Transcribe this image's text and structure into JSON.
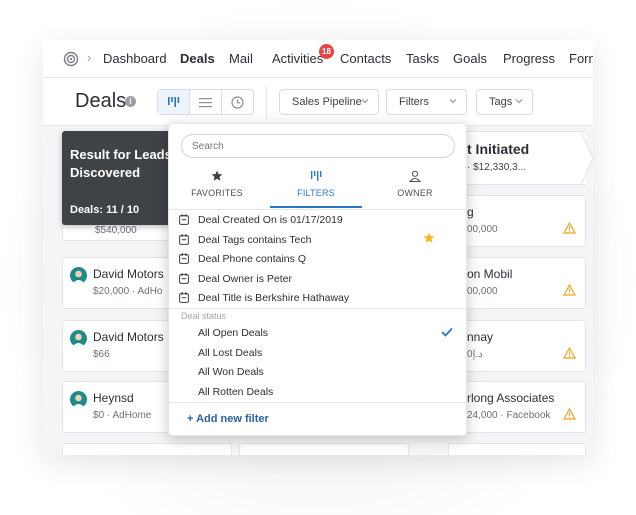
{
  "nav": {
    "items": [
      "Dashboard",
      "Deals",
      "Mail",
      "Activities",
      "Contacts",
      "Tasks",
      "Goals",
      "Progress",
      "Form"
    ],
    "activities_badge": "18"
  },
  "toolbar": {
    "title": "Deals",
    "pipeline_label": "Sales Pipeline",
    "filters_label": "Filters",
    "tags_label": "Tags"
  },
  "board": {
    "left_stage": {
      "title": "Result for Leads Discovered",
      "count": "Deals: 11 / 10"
    },
    "right_stage": {
      "title": "t Initiated",
      "sub": "· $12,330,3..."
    },
    "left_cards": [
      {
        "name": "",
        "sub": "$540,000"
      },
      {
        "name": "David Motors",
        "sub": "$20,000  · AdHo"
      },
      {
        "name": "David Motors",
        "sub": "$66"
      },
      {
        "name": "Heynsd",
        "sub": "$0  · AdHome"
      }
    ],
    "right_cards": [
      {
        "name": "g",
        "sub": "00,000"
      },
      {
        "name": "on Mobil",
        "sub": "00,000"
      },
      {
        "name": "nnay",
        "sub": "د.إ0"
      },
      {
        "name": "rlong Associates",
        "sub": "24,000  · Facebook"
      }
    ]
  },
  "filter_panel": {
    "search_placeholder": "Search",
    "tabs": [
      "FAVORITES",
      "FILTERS",
      "OWNER"
    ],
    "filters": [
      "Deal Created On is 01/17/2019",
      "Deal Tags contains Tech",
      "Deal Phone contains Q",
      "Deal Owner is Peter",
      "Deal Title is Berkshire Hathaway"
    ],
    "status_section_title": "Deal status",
    "statuses": [
      "All Open Deals",
      "All Lost Deals",
      "All Won Deals",
      "All Rotten Deals"
    ],
    "selected_status": "All Open Deals",
    "add_filter_label": "+ Add new filter"
  },
  "colors": {
    "accent": "#2a76c6",
    "badge": "#e44545",
    "star": "#f2b91c",
    "warning": "#f0a21a",
    "stage_dark": "#3f4247"
  }
}
